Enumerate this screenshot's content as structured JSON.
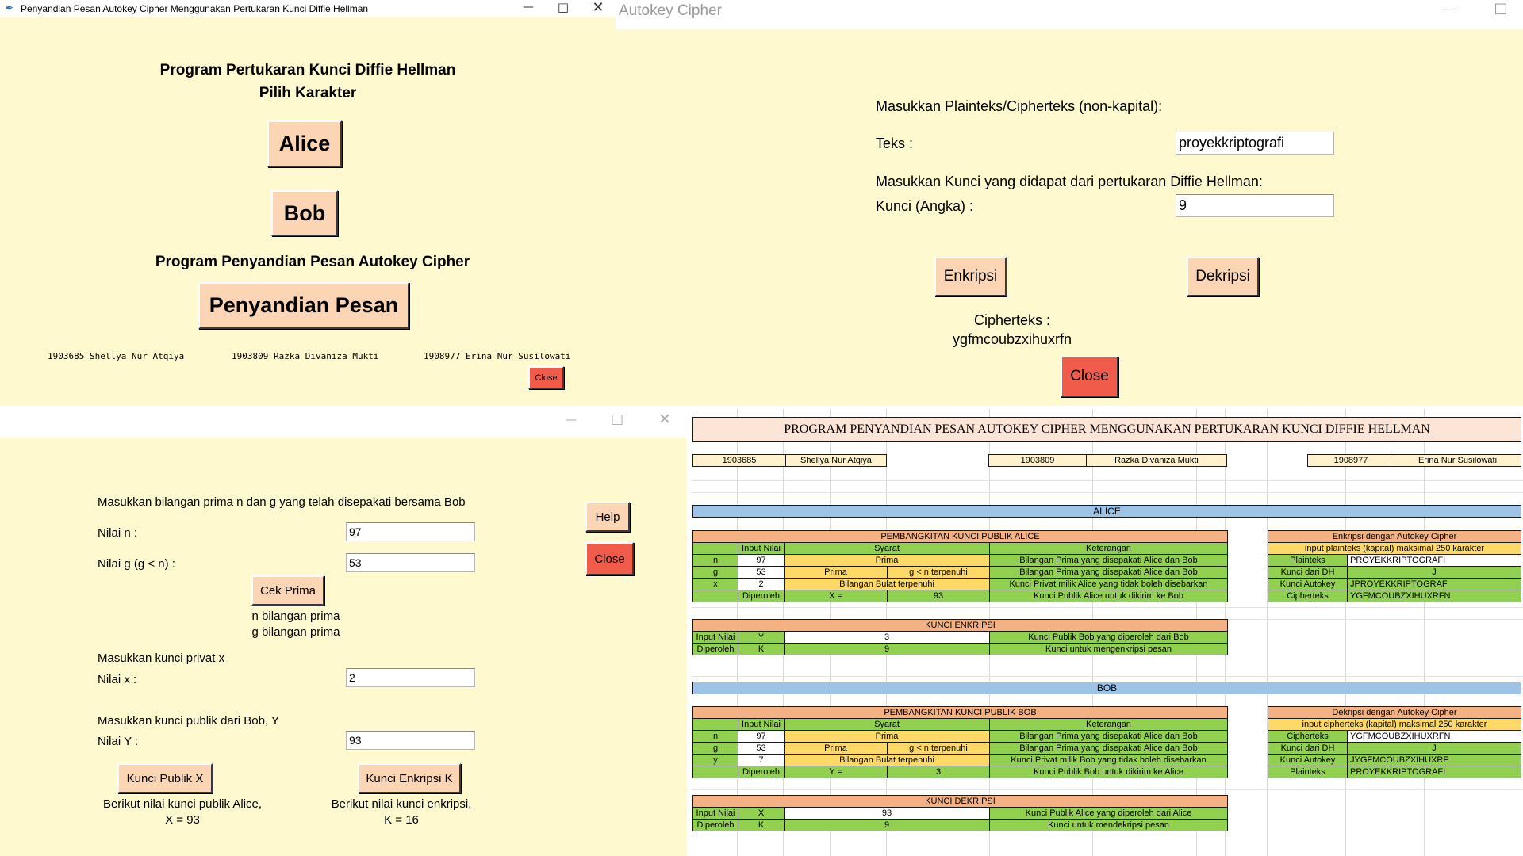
{
  "win1": {
    "title": "Penyandian Pesan Autokey Cipher Menggunakan Pertukaran Kunci Diffie Hellman",
    "heading1": "Program Pertukaran Kunci Diffie Hellman",
    "heading2": "Pilih Karakter",
    "alice_button": "Alice",
    "bob_button": "Bob",
    "heading3": "Program Penyandian Pesan Autokey Cipher",
    "encode_button": "Penyandian Pesan",
    "credits": [
      "1903685 Shellya Nur Atqiya",
      "1903809 Razka Divaniza Mukti",
      "1908977 Erina Nur Susilowati"
    ],
    "close_button": "Close"
  },
  "win2": {
    "title": "Autokey Cipher",
    "prompt_text": "Masukkan Plainteks/Cipherteks (non-kapital):",
    "teks_label": "Teks :",
    "teks_value": "proyekkriptografi",
    "prompt_key": "Masukkan Kunci yang didapat dari pertukaran Diffie Hellman:",
    "kunci_label": "Kunci (Angka) :",
    "kunci_value": "9",
    "encrypt_button": "Enkripsi",
    "decrypt_button": "Dekripsi",
    "result_label": "Cipherteks :",
    "result_value": "ygfmcoubzxihuxrfn",
    "close_button": "Close"
  },
  "win3": {
    "prompt_ng": "Masukkan bilangan prima n dan g yang telah disepakati bersama Bob",
    "n_label": "Nilai n :",
    "n_value": "97",
    "g_label": "Nilai g (g < n) :",
    "g_value": "53",
    "check_button": "Cek Prima",
    "n_status": "n bilangan prima",
    "g_status": "g bilangan prima",
    "prompt_x": "Masukkan kunci privat x",
    "x_label": "Nilai x :",
    "x_value": "2",
    "prompt_y": "Masukkan kunci publik dari Bob, Y",
    "y_label": "Nilai Y :",
    "y_value": "93",
    "help_button": "Help",
    "close_button": "Close",
    "public_key_button": "Kunci Publik X",
    "enc_key_button": "Kunci Enkripsi K",
    "public_result_1": "Berikut nilai kunci publik Alice,",
    "public_result_2": "X = 93",
    "enc_result_1": "Berikut nilai kunci enkripsi,",
    "enc_result_2": "K = 16"
  },
  "sheet": {
    "title": "PROGRAM PENYANDIAN PESAN AUTOKEY CIPHER MENGGUNAKAN PERTUKARAN KUNCI DIFFIE HELLMAN",
    "ids": [
      {
        "nim": "1903685",
        "name": "Shellya Nur Atqiya"
      },
      {
        "nim": "1903809",
        "name": "Razka Divaniza Mukti"
      },
      {
        "nim": "1908977",
        "name": "Erina Nur Susilowati"
      }
    ],
    "alice": {
      "section": "ALICE",
      "gen_title": "PEMBANGKITAN KUNCI PUBLIK ALICE",
      "hdr_input": "Input Nilai",
      "hdr_syarat": "Syarat",
      "hdr_ket": "Keterangan",
      "rows": [
        {
          "k": "n",
          "v": "97",
          "s1": "Prima",
          "s2": "",
          "ket": "Bilangan Prima yang disepakati Alice dan Bob"
        },
        {
          "k": "g",
          "v": "53",
          "s1": "Prima",
          "s2": "g < n terpenuhi",
          "ket": "Bilangan Prima yang disepakati Alice dan Bob"
        },
        {
          "k": "x",
          "v": "2",
          "s1": "Bilangan Bulat terpenuhi",
          "s2": "",
          "ket": "Kunci Privat milik Alice yang tidak boleh disebarkan"
        }
      ],
      "result": {
        "k": "Diperoleh",
        "s1": "X =",
        "s2": "93",
        "ket": "Kunci Publik Alice untuk dikirim ke Bob"
      },
      "key_title": "KUNCI ENKRIPSI",
      "key_rows": [
        {
          "k": "Input Nilai",
          "sym": "Y",
          "v": "3",
          "ket": "Kunci Publik Bob yang diperoleh dari Bob"
        },
        {
          "k": "Diperoleh",
          "sym": "K",
          "v": "9",
          "ket": "Kunci untuk mengenkripsi pesan"
        }
      ],
      "cipher_title": "Enkripsi dengan Autokey Cipher",
      "cipher_note": "input plainteks (kapital) maksimal 250 karakter",
      "cipher_rows": [
        {
          "k": "Plainteks",
          "v": "PROYEKKRIPTOGRAFI"
        },
        {
          "k": "Kunci dari DH",
          "v": "J"
        },
        {
          "k": "Kunci Autokey",
          "v": "JPROYEKKRIPTOGRAF"
        },
        {
          "k": "Cipherteks",
          "v": "YGFMCOUBZXIHUXRFN"
        }
      ]
    },
    "bob": {
      "section": "BOB",
      "gen_title": "PEMBANGKITAN KUNCI PUBLIK BOB",
      "hdr_input": "Input Nilai",
      "hdr_syarat": "Syarat",
      "hdr_ket": "Keterangan",
      "rows": [
        {
          "k": "n",
          "v": "97",
          "s1": "Prima",
          "s2": "",
          "ket": "Bilangan Prima yang disepakati Alice dan Bob"
        },
        {
          "k": "g",
          "v": "53",
          "s1": "Prima",
          "s2": "g < n terpenuhi",
          "ket": "Bilangan Prima yang disepakati Alice dan Bob"
        },
        {
          "k": "y",
          "v": "7",
          "s1": "Bilangan Bulat terpenuhi",
          "s2": "",
          "ket": "Kunci Privat milik Bob yang tidak boleh disebarkan"
        }
      ],
      "result": {
        "k": "Diperoleh",
        "s1": "Y =",
        "s2": "3",
        "ket": "Kunci Publik Bob untuk dikirim ke Alice"
      },
      "key_title": "KUNCI DEKRIPSI",
      "key_rows": [
        {
          "k": "Input Nilai",
          "sym": "X",
          "v": "93",
          "ket": "Kunci Publik Alice yang diperoleh dari Alice"
        },
        {
          "k": "Diperoleh",
          "sym": "K",
          "v": "9",
          "ket": "Kunci untuk mendekripsi pesan"
        }
      ],
      "cipher_title": "Dekripsi dengan Autokey Cipher",
      "cipher_note": "input cipherteks (kapital) maksimal 250 karakter",
      "cipher_rows": [
        {
          "k": "Cipherteks",
          "v": "YGFMCOUBZXIHUXRFN"
        },
        {
          "k": "Kunci dari DH",
          "v": "J"
        },
        {
          "k": "Kunci Autokey",
          "v": "JYGFMCOUBZXIHUXRF"
        },
        {
          "k": "Plainteks",
          "v": "PROYEKKRIPTOGRAFI"
        }
      ]
    }
  }
}
